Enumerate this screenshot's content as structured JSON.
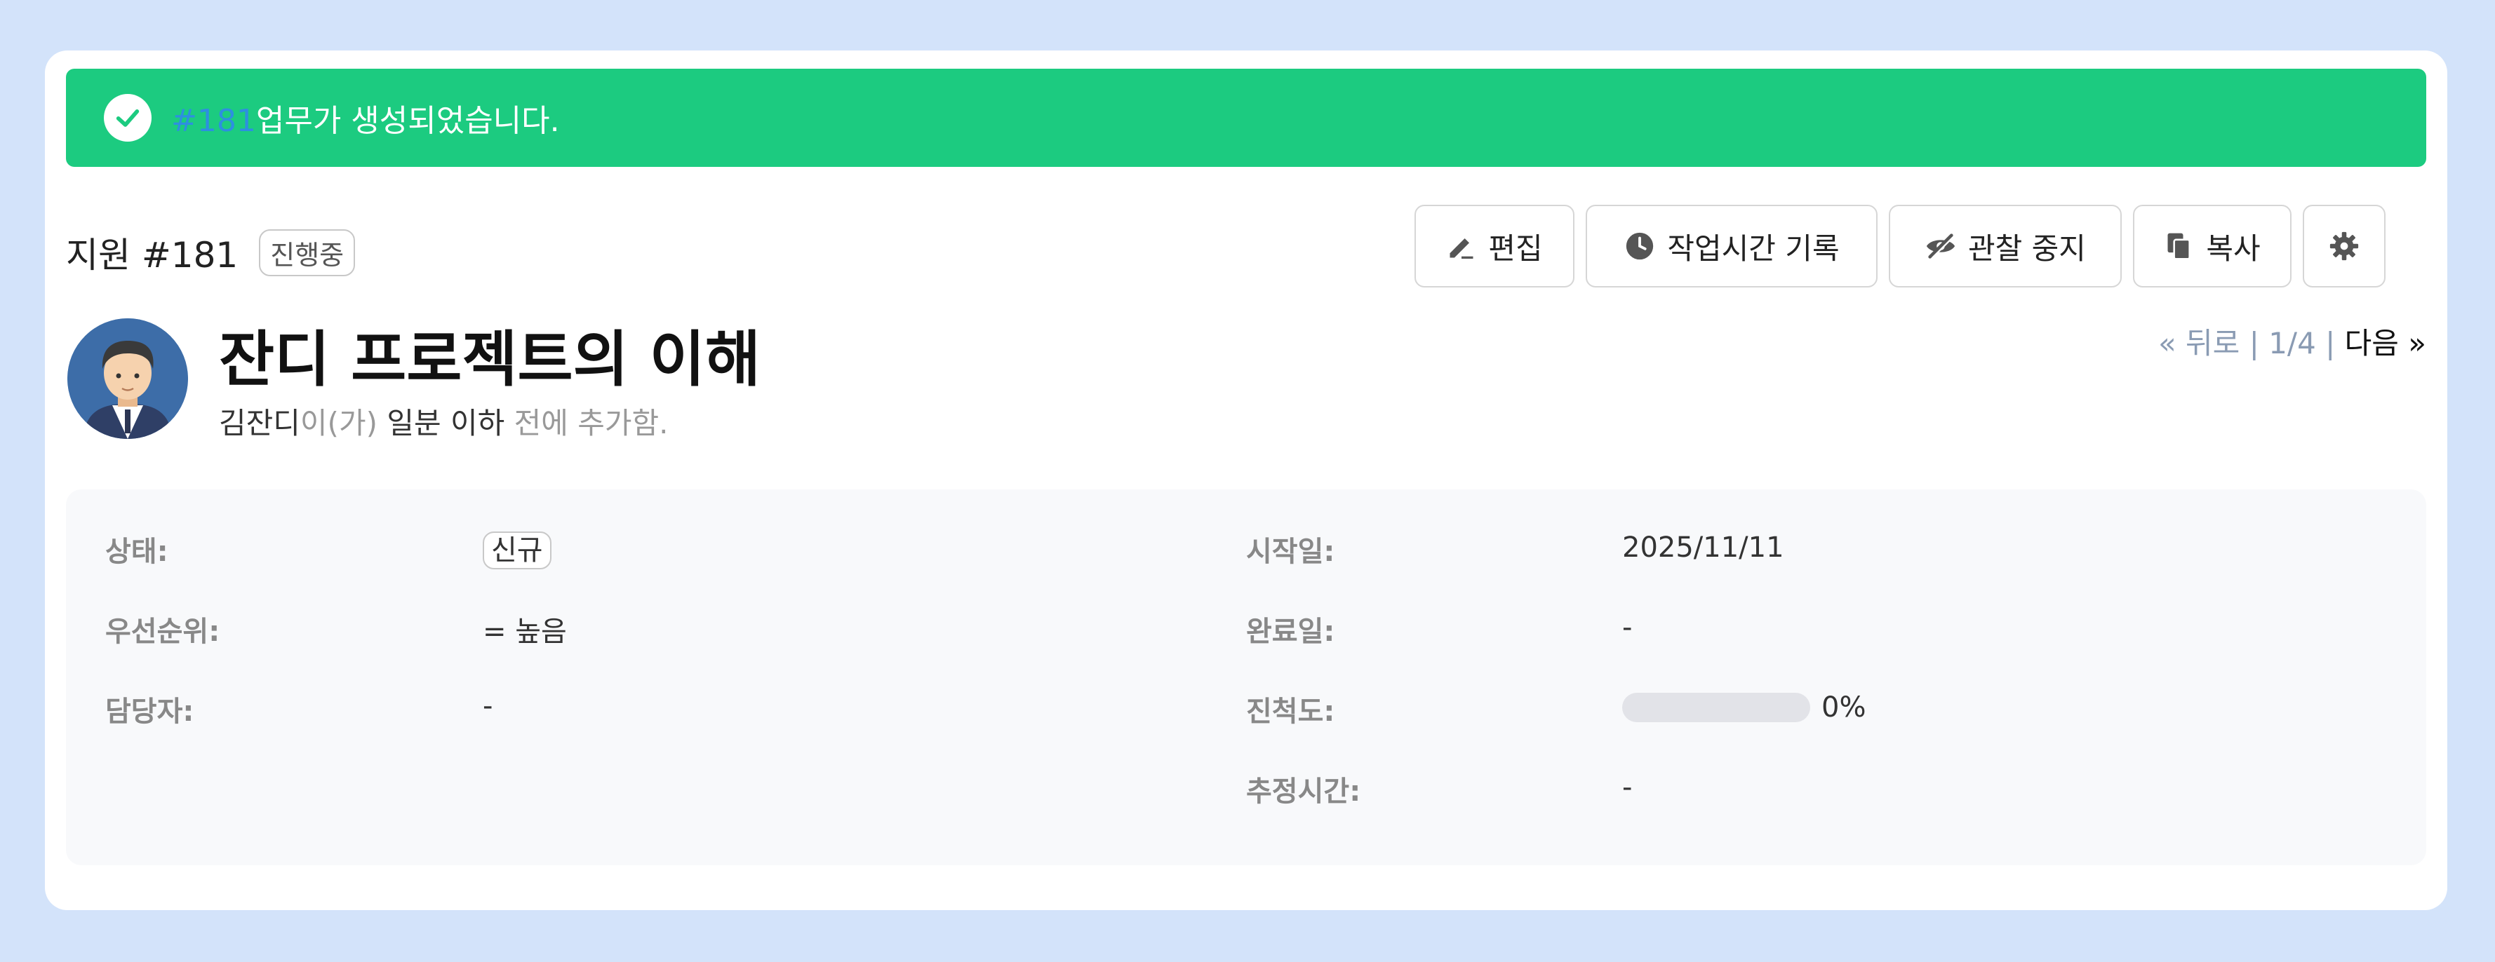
{
  "flash": {
    "issue_link": "#181",
    "message": "업무가 생성되었습니다."
  },
  "issue": {
    "tracker_label": "지원 #181",
    "status_badge": "진행중",
    "subject": "잔디 프로젝트의 이해",
    "author": "김잔디",
    "author_suffix": "이(가)",
    "time_ago": "일분 이하",
    "added_suffix": "전에 추가함."
  },
  "toolbar": {
    "edit_label": "편집",
    "log_time_label": "작업시간 기록",
    "unwatch_label": "관찰 중지",
    "copy_label": "복사"
  },
  "pager": {
    "back_label": "« 뒤로",
    "sep1": "|",
    "position": "1/4",
    "sep2": "|",
    "next_label": "다음 »"
  },
  "attributes": {
    "status_label": "상태:",
    "status_value": "신규",
    "priority_label": "우선순위:",
    "priority_value": "= 높음",
    "assignee_label": "담당자:",
    "assignee_value": "-",
    "start_date_label": "시작일:",
    "start_date_value": "2025/11/11",
    "due_date_label": "완료일:",
    "due_date_value": "-",
    "progress_label": "진척도:",
    "progress_value": "0%",
    "progress_fraction": 0,
    "estimated_label": "추정시간:",
    "estimated_value": "-"
  },
  "colors": {
    "page_bg": "#d3e3fa",
    "flash_bg": "#1ccb80",
    "link": "#2d8fe0"
  }
}
